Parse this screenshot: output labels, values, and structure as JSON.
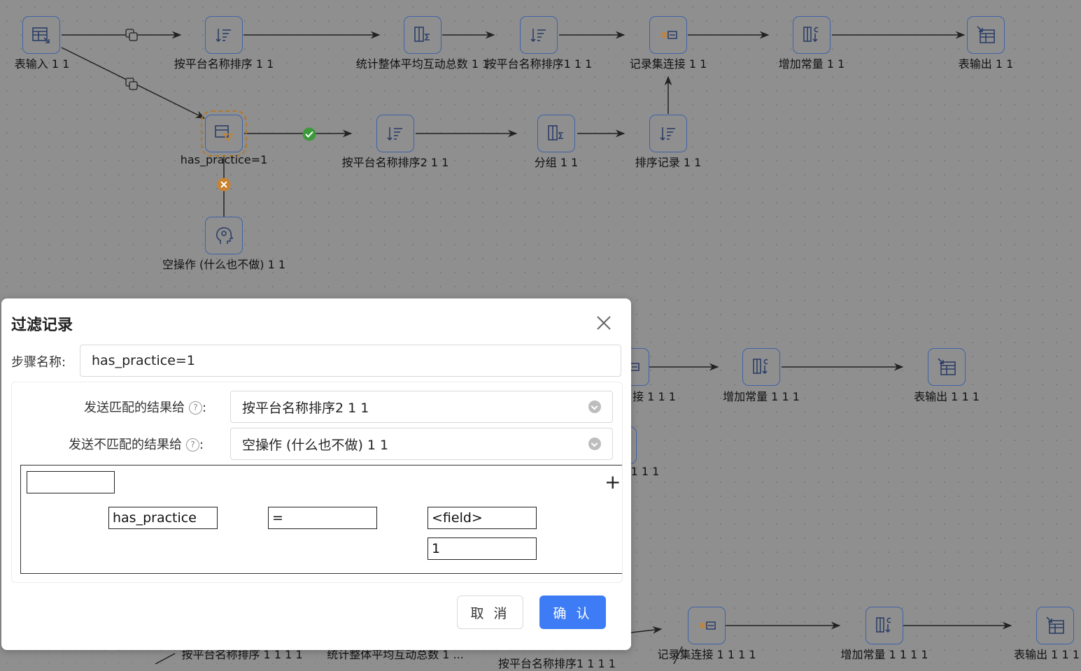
{
  "canvas": {
    "nodes": {
      "table_input": "表输入 1 1",
      "sort_platform_1": "按平台名称排序 1 1",
      "stats_avg": "统计整体平均互动总数 1 1",
      "sort_platform_1b": "按平台名称排序1 1 1",
      "merge_join": "记录集连接 1 1",
      "add_const": "增加常量 1 1",
      "table_output": "表输出 1 1",
      "filter": "has_practice=1",
      "sort_platform_2": "按平台名称排序2 1 1",
      "group": "分组 1 1",
      "sort_rows": "排序记录 1 1",
      "dummy": "空操作 (什么也不做) 1 1",
      "r2_merge_tail": "接 1 1 1",
      "r2_add_const": "增加常量 1 1 1",
      "r2_output": "表输出 1 1 1",
      "r2_row3_tail": "1 1 1",
      "r3_sort": "按平台名称排序 1 1 1 1",
      "r3_stats": "统计整体平均互动总数 1 ...",
      "r3_sort1": "按平台名称排序1 1 1 1",
      "r3_merge": "记录集连接 1 1 1 1",
      "r3_add_const": "增加常量 1 1 1 1",
      "r3_output": "表输出 1 1 1"
    },
    "colors": {
      "node_border": "#3f63a8",
      "ok_hop": "#3c9a3c",
      "fail_hop": "#c9822e"
    }
  },
  "dialog": {
    "title": "过滤记录",
    "step_name_label": "步骤名称:",
    "step_name_value": "has_practice=1",
    "send_true_label": "发送匹配的结果给",
    "send_true_value": "按平台名称排序2 1 1",
    "send_false_label": "发送不匹配的结果给",
    "send_false_value": "空操作 (什么也不做) 1 1",
    "condition": {
      "field": "has_practice",
      "operator": "=",
      "value_type": "<field>",
      "value": "1",
      "add_symbol": "+"
    },
    "cancel_label": "取 消",
    "ok_label": "确 认",
    "colors": {
      "primary": "#3d7cf4"
    }
  }
}
